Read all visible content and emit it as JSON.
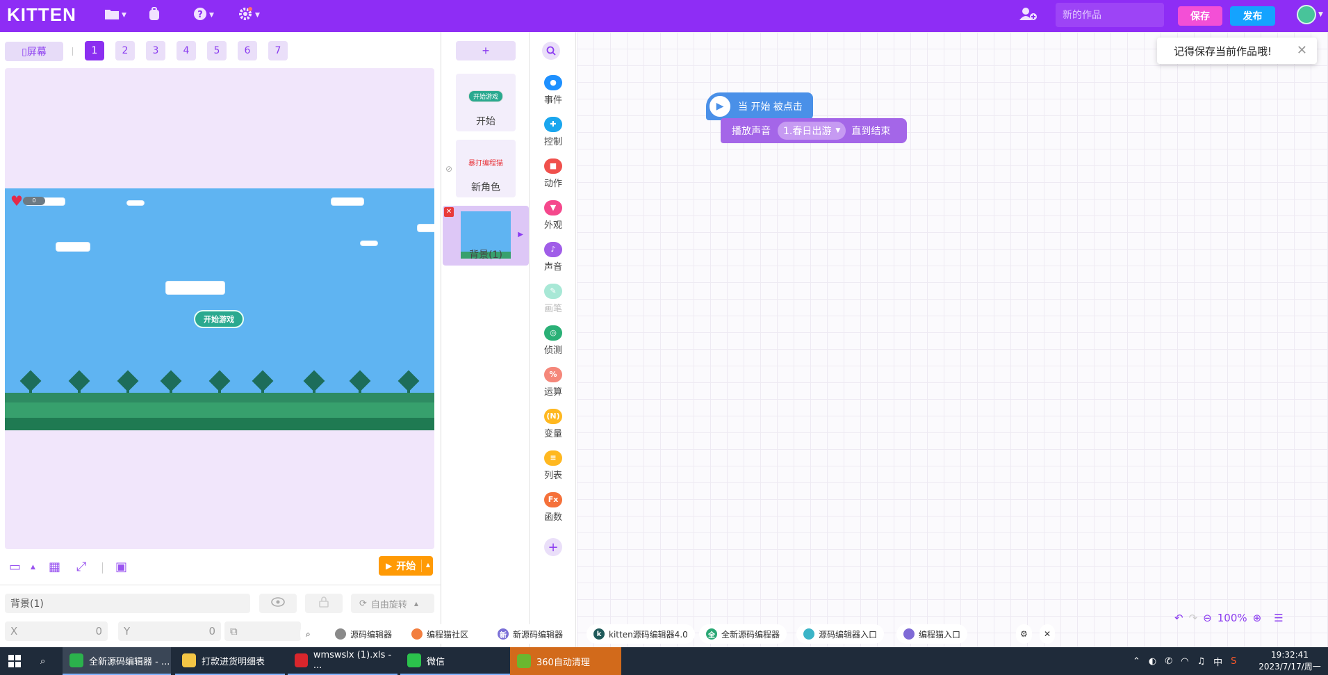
{
  "app": {
    "logo": "KITTEN"
  },
  "header": {
    "title_placeholder": "新的作品",
    "save_label": "保存",
    "publish_label": "发布"
  },
  "stage": {
    "screen_label": "屏幕",
    "pages": [
      "1",
      "2",
      "3",
      "4",
      "5",
      "6",
      "7"
    ],
    "active_page": "1",
    "start_game_label": "开始游戏",
    "hud_value": "0",
    "run_label": "开始"
  },
  "properties": {
    "sprite_name": "背景(1)",
    "rotate_label": "自由旋转",
    "x_label": "X",
    "x_value": "0",
    "y_label": "Y",
    "y_value": "0"
  },
  "sprites": {
    "add_label": "+",
    "items": [
      {
        "label": "开始",
        "thumb_text": "开始游戏"
      },
      {
        "label": "新角色",
        "thumb_text": "暴打编程猫"
      }
    ],
    "background_label": "背景(1)"
  },
  "categories": [
    {
      "name": "事件",
      "color": "#1e90ff"
    },
    {
      "name": "控制",
      "color": "#1aa6ee"
    },
    {
      "name": "动作",
      "color": "#f0504c"
    },
    {
      "name": "外观",
      "color": "#f5488c"
    },
    {
      "name": "声音",
      "color": "#a05de8"
    },
    {
      "name": "画笔",
      "color": "#a8e8d6"
    },
    {
      "name": "侦测",
      "color": "#2ab076"
    },
    {
      "name": "运算",
      "color": "#f5877a"
    },
    {
      "name": "变量",
      "color": "#ffb820"
    },
    {
      "name": "列表",
      "color": "#ffb820"
    },
    {
      "name": "函数",
      "color": "#f5713a"
    }
  ],
  "workspace": {
    "toast_text": "记得保存当前作品哦!",
    "hat_block_text": "当 开始 被点击",
    "sound_block_prefix": "播放声音",
    "sound_block_value": "1.春日出游",
    "sound_block_suffix": "直到结束",
    "zoom": "100%"
  },
  "ext_tabs": [
    {
      "label": "源码编辑器",
      "icon_color": "#8a8a8a"
    },
    {
      "label": "编程猫社区",
      "icon_color": "#f27e3f"
    },
    {
      "label": "新源码编辑器",
      "icon_color": "#7a6fd6"
    },
    {
      "label": "kitten源码编辑器4.0",
      "icon_color": "#1f5a5a"
    },
    {
      "label": "全新源码编程器",
      "icon_color": "#29a774"
    },
    {
      "label": "源码编辑器入口",
      "icon_color": "#3bb4c7"
    },
    {
      "label": "编程猫入口",
      "icon_color": "#7f6ad6"
    }
  ],
  "taskbar": {
    "items": [
      {
        "label": "全新源码编辑器 - ...",
        "icon_color": "#2bb24c"
      },
      {
        "label": "打款进货明细表",
        "icon_color": "#f3c545"
      },
      {
        "label": "wmswslx (1).xls - ...",
        "icon_color": "#d9262c"
      },
      {
        "label": "微信",
        "icon_color": "#2bc24c"
      },
      {
        "label": "360自动清理",
        "icon_color": "#6ab72f"
      }
    ],
    "ime": "中",
    "time": "19:32:41",
    "date": "2023/7/17/周一"
  }
}
